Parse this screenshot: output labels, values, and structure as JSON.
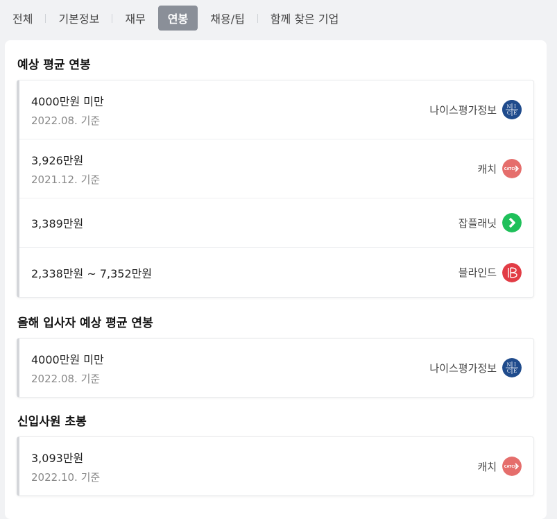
{
  "tabs": [
    {
      "label": "전체",
      "active": false
    },
    {
      "label": "기본정보",
      "active": false
    },
    {
      "label": "재무",
      "active": false
    },
    {
      "label": "연봉",
      "active": true
    },
    {
      "label": "채용/팁",
      "active": false
    },
    {
      "label": "함께 찾은 기업",
      "active": false
    }
  ],
  "sections": {
    "avg_salary": {
      "title": "예상 평균 연봉",
      "rows": [
        {
          "value": "4000만원 미만",
          "date": "2022.08. 기준",
          "source": "나이스평가정보",
          "logo": "nice-logo-icon"
        },
        {
          "value": "3,926만원",
          "date": "2021.12. 기준",
          "source": "캐치",
          "logo": "catch-logo-icon"
        },
        {
          "value": "3,389만원",
          "date": "",
          "source": "잡플래닛",
          "logo": "jobplanet-logo-icon"
        },
        {
          "value": "2,338만원 ~ 7,352만원",
          "date": "",
          "source": "블라인드",
          "logo": "blind-logo-icon"
        }
      ]
    },
    "new_hire_salary": {
      "title": "올해 입사자 예상 평균 연봉",
      "rows": [
        {
          "value": "4000만원 미만",
          "date": "2022.08. 기준",
          "source": "나이스평가정보",
          "logo": "nice-logo-icon"
        }
      ]
    },
    "starting_salary": {
      "title": "신입사원 초봉",
      "rows": [
        {
          "value": "3,093만원",
          "date": "2022.10. 기준",
          "source": "캐치",
          "logo": "catch-logo-icon"
        }
      ]
    }
  },
  "logos": {
    "nice_letters": [
      "N",
      "I",
      "C",
      "E"
    ],
    "catch_text": "CATCH"
  },
  "colors": {
    "active_tab_bg": "#8a8f98",
    "nice": "#1f4b8c",
    "catch": "#e56e6c",
    "jobplanet": "#1fc05a",
    "blind": "#e23c45"
  }
}
